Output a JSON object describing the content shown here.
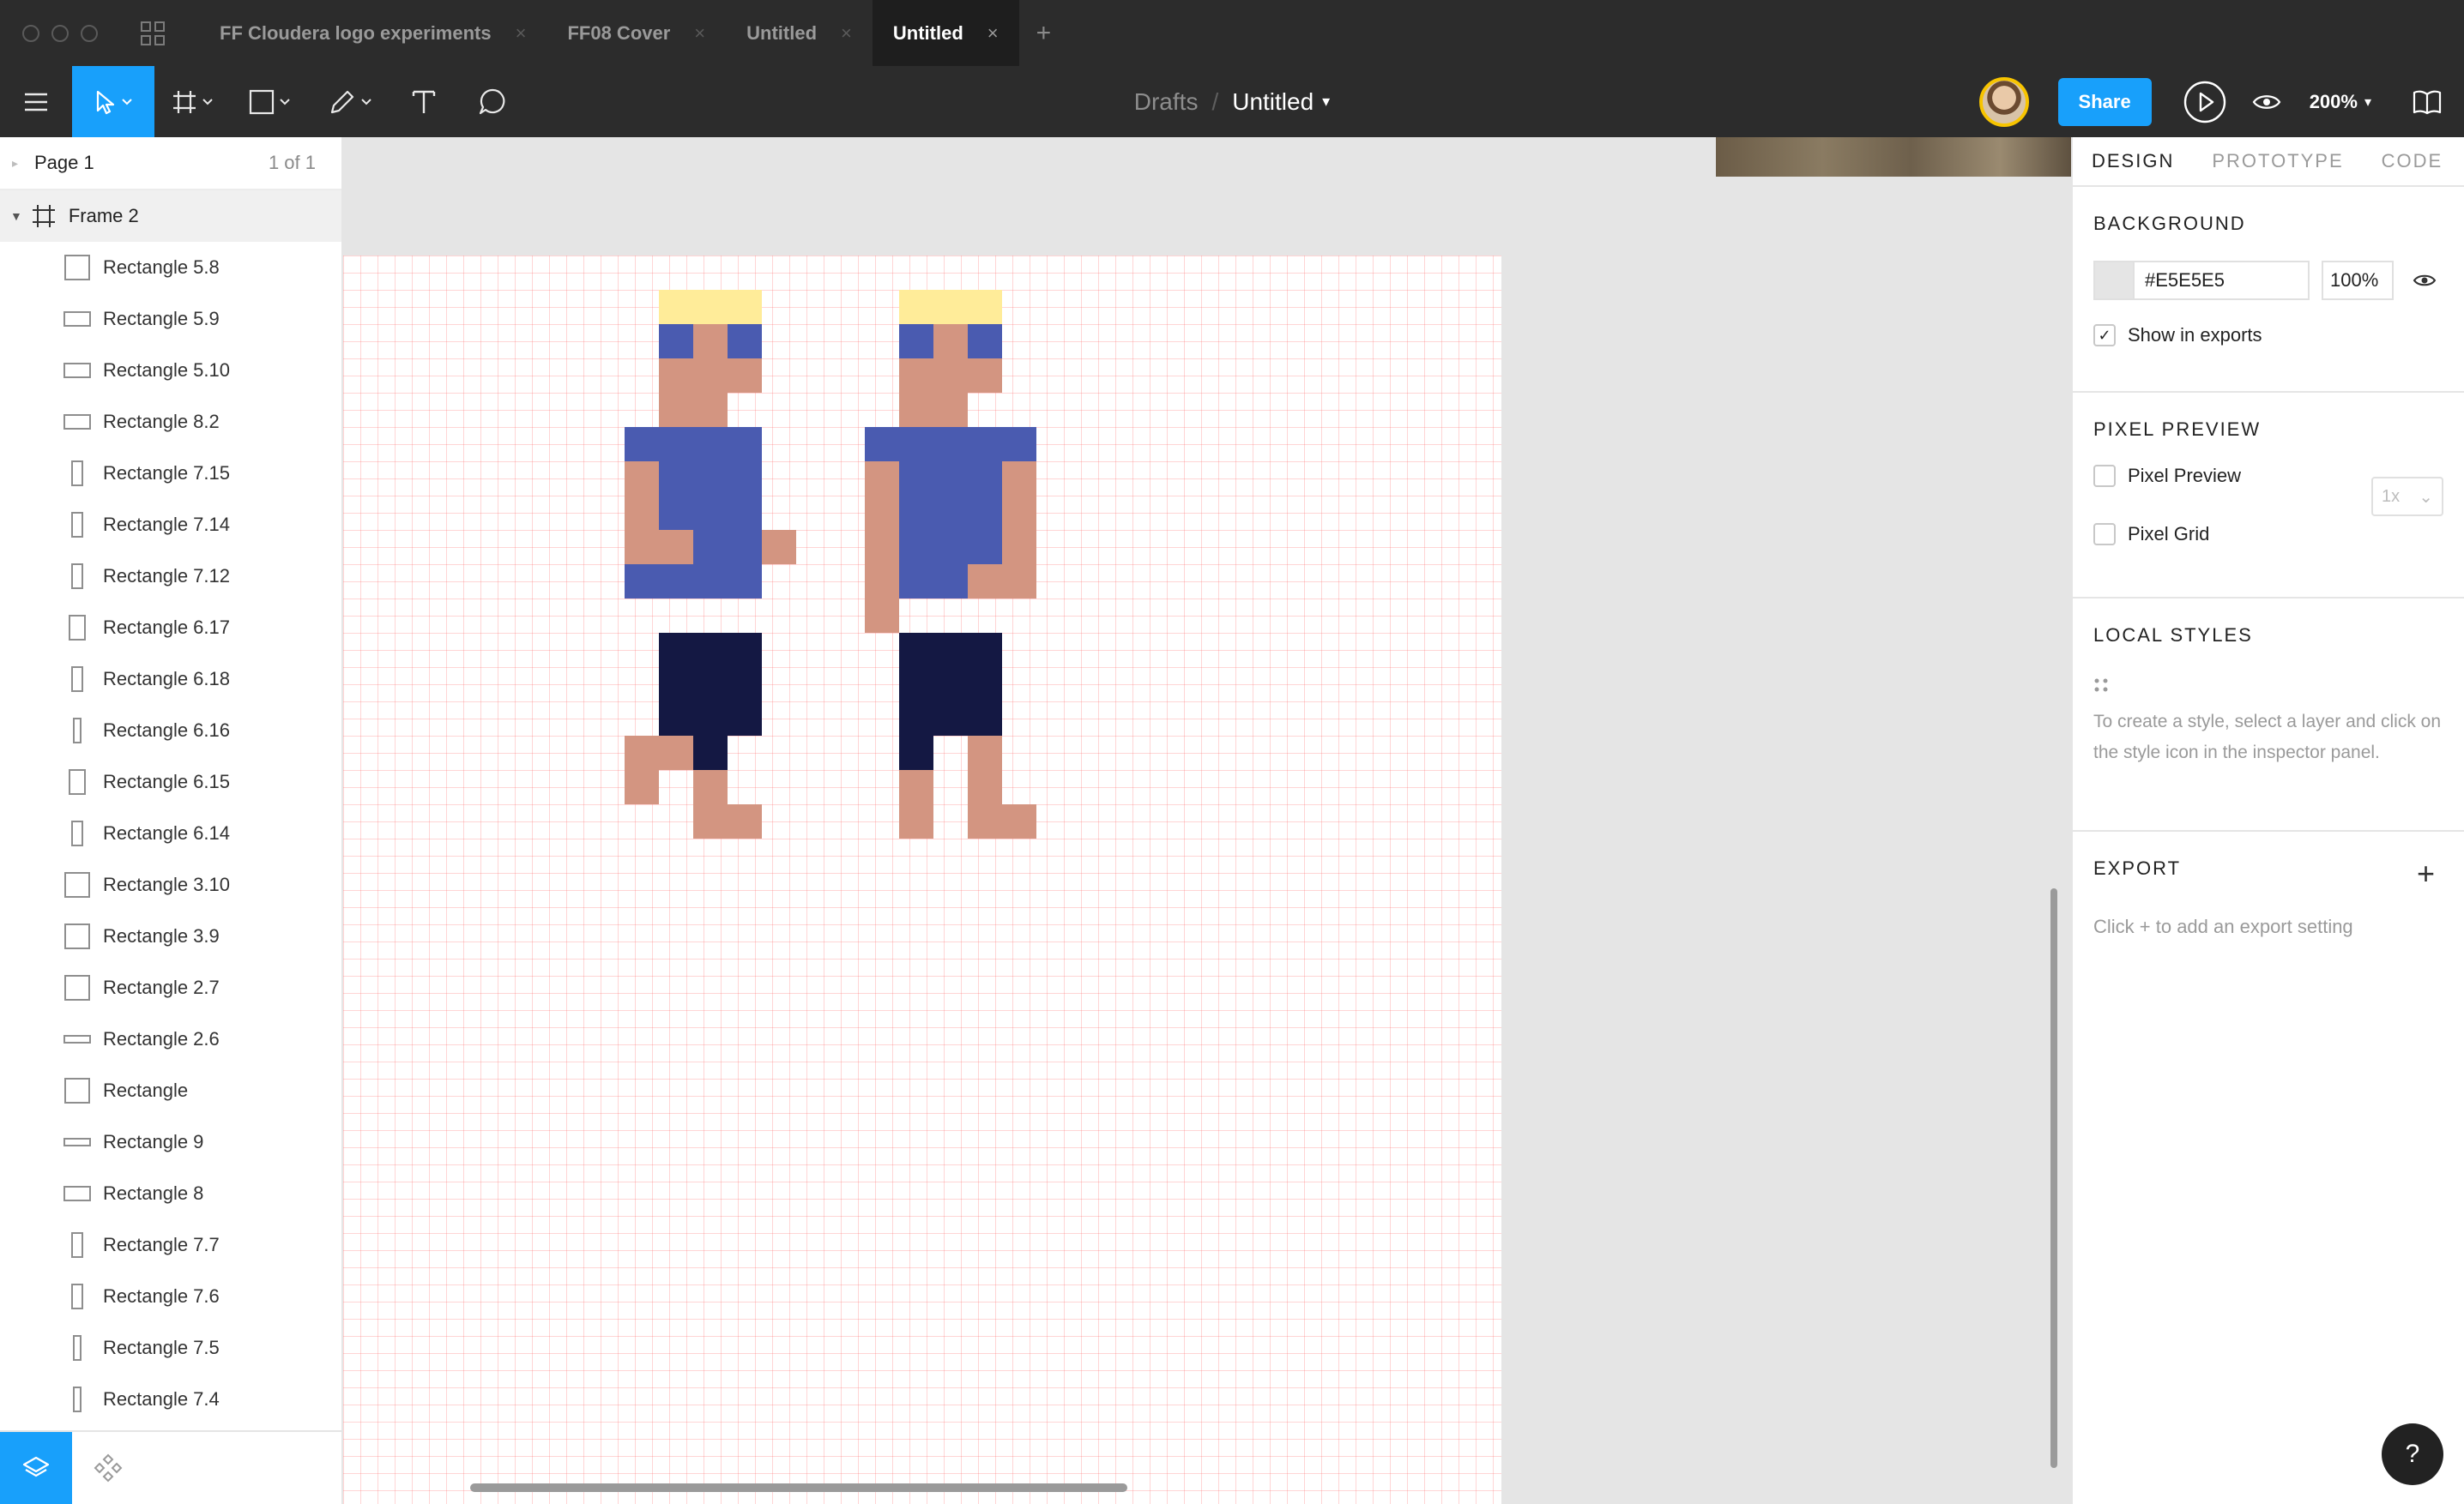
{
  "titlebar": {
    "tabs": [
      {
        "label": "FF Cloudera logo experiments",
        "active": false
      },
      {
        "label": "FF08 Cover",
        "active": false
      },
      {
        "label": "Untitled",
        "active": false
      },
      {
        "label": "Untitled",
        "active": true
      }
    ],
    "close_glyph": "×",
    "add_glyph": "+"
  },
  "toolbar": {
    "breadcrumb_drafts": "Drafts",
    "breadcrumb_sep": "/",
    "file_name": "Untitled",
    "share_label": "Share",
    "zoom": "200%",
    "accent": "#18A0FB"
  },
  "layers_panel": {
    "page_name": "Page 1",
    "page_count": "1 of 1",
    "frame_name": "Frame 2",
    "layers": [
      {
        "name": "Rectangle 5.8",
        "icon": "square"
      },
      {
        "name": "Rectangle 5.9",
        "icon": "wide"
      },
      {
        "name": "Rectangle 5.10",
        "icon": "wide"
      },
      {
        "name": "Rectangle 8.2",
        "icon": "wide"
      },
      {
        "name": "Rectangle 7.15",
        "icon": "tall"
      },
      {
        "name": "Rectangle 7.14",
        "icon": "tall"
      },
      {
        "name": "Rectangle 7.12",
        "icon": "tall"
      },
      {
        "name": "Rectangle 6.17",
        "icon": "tall-wide"
      },
      {
        "name": "Rectangle 6.18",
        "icon": "tall"
      },
      {
        "name": "Rectangle 6.16",
        "icon": "tall-thin"
      },
      {
        "name": "Rectangle 6.15",
        "icon": "tall-wide"
      },
      {
        "name": "Rectangle 6.14",
        "icon": "tall"
      },
      {
        "name": "Rectangle 3.10",
        "icon": "square"
      },
      {
        "name": "Rectangle 3.9",
        "icon": "square"
      },
      {
        "name": "Rectangle 2.7",
        "icon": "square"
      },
      {
        "name": "Rectangle 2.6",
        "icon": "flat"
      },
      {
        "name": "Rectangle",
        "icon": "square"
      },
      {
        "name": "Rectangle 9",
        "icon": "flat"
      },
      {
        "name": "Rectangle 8",
        "icon": "wide"
      },
      {
        "name": "Rectangle 7.7",
        "icon": "tall"
      },
      {
        "name": "Rectangle 7.6",
        "icon": "tall"
      },
      {
        "name": "Rectangle 7.5",
        "icon": "tall-thin"
      },
      {
        "name": "Rectangle 7.4",
        "icon": "tall-thin"
      }
    ]
  },
  "canvas": {
    "frame_background": "#FFFFFF",
    "grid_color": "#FF6969",
    "colors": {
      "hair": "#FFEC99",
      "blue": "#4A5BB0",
      "skin": "#D39581",
      "pants": "#141843"
    }
  },
  "design_panel": {
    "tabs": [
      "DESIGN",
      "PROTOTYPE",
      "CODE"
    ],
    "background_heading": "BACKGROUND",
    "background_hex": "#E5E5E5",
    "background_opacity": "100%",
    "show_in_exports": "Show in exports",
    "pixel_preview_heading": "PIXEL PREVIEW",
    "pixel_preview_label": "Pixel Preview",
    "pixel_grid_label": "Pixel Grid",
    "scale_value": "1x",
    "local_styles_heading": "LOCAL STYLES",
    "local_styles_help": "To create a style, select a layer and click on the style icon in the inspector panel.",
    "export_heading": "EXPORT",
    "export_help": "Click + to add an export setting",
    "help_label": "?"
  }
}
